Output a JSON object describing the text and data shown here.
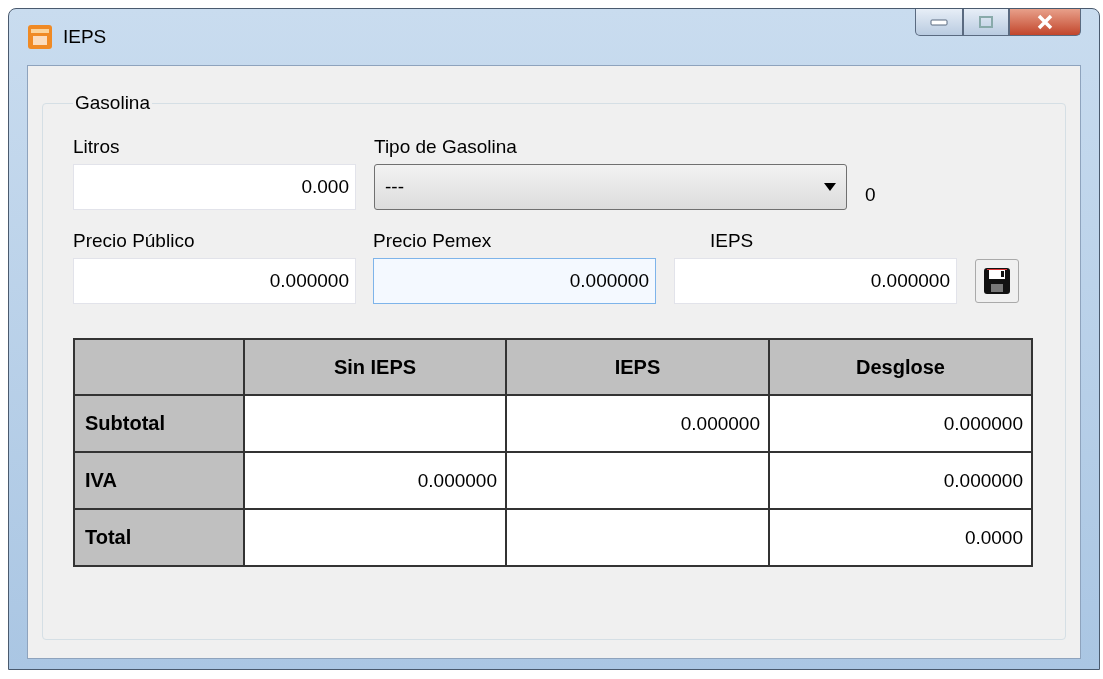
{
  "window": {
    "title": "IEPS"
  },
  "group": {
    "title": "Gasolina"
  },
  "litros": {
    "label": "Litros",
    "value": "0.000"
  },
  "tipo_gasolina": {
    "label": "Tipo de Gasolina",
    "value": "---",
    "code": "0"
  },
  "prices": [
    {
      "label": "Precio Público",
      "value": "0.000000",
      "focused": false
    },
    {
      "label": "Precio Pemex",
      "value": "0.000000",
      "focused": true
    },
    {
      "label": "IEPS",
      "value": "0.000000",
      "focused": false
    }
  ],
  "table": {
    "columns": [
      "Sin IEPS",
      "IEPS",
      "Desglose"
    ],
    "rows": [
      {
        "label": "Subtotal",
        "cells": [
          null,
          "0.000000",
          "0.000000"
        ]
      },
      {
        "label": "IVA",
        "cells": [
          "0.000000",
          null,
          "0.000000"
        ]
      },
      {
        "label": "Total",
        "cells": [
          null,
          null,
          "0.0000"
        ]
      }
    ]
  }
}
